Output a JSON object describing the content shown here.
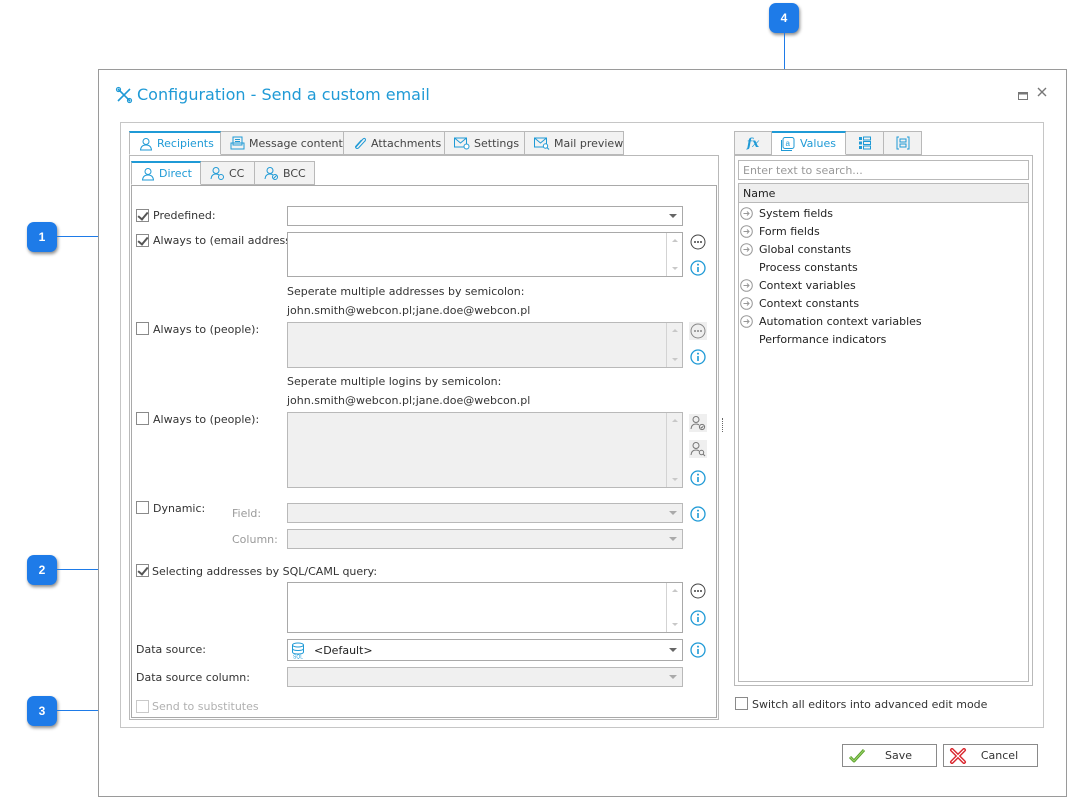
{
  "callouts": [
    "1",
    "2",
    "3",
    "4"
  ],
  "dialog": {
    "title": "Configuration - Send a custom email",
    "maximize_label": "□",
    "close_label": "✕"
  },
  "main_tabs": [
    {
      "label": "Recipients",
      "icon": "user-icon",
      "active": true
    },
    {
      "label": "Message content",
      "icon": "message-icon",
      "active": false
    },
    {
      "label": "Attachments",
      "icon": "paperclip-icon",
      "active": false
    },
    {
      "label": "Settings",
      "icon": "mail-settings-icon",
      "active": false
    },
    {
      "label": "Mail preview",
      "icon": "mail-preview-icon",
      "active": false
    }
  ],
  "sub_tabs": [
    {
      "label": "Direct",
      "icon": "user-icon",
      "active": true
    },
    {
      "label": "CC",
      "icon": "user-cc-icon",
      "active": false
    },
    {
      "label": "BCC",
      "icon": "user-bcc-icon",
      "active": false
    }
  ],
  "form": {
    "predefined": {
      "label": "Predefined:",
      "checked": true,
      "value": ""
    },
    "always_to_email": {
      "label": "Always to (email address):",
      "checked": true,
      "value": "",
      "hint": "Seperate multiple addresses by semicolon:",
      "example": "john.smith@webcon.pl;jane.doe@webcon.pl"
    },
    "always_to_people_1": {
      "label": "Always to (people):",
      "checked": false,
      "value": "",
      "hint": "Seperate multiple logins by semicolon:",
      "example": "john.smith@webcon.pl;jane.doe@webcon.pl"
    },
    "always_to_people_2": {
      "label": "Always to (people):",
      "checked": false,
      "value": ""
    },
    "dynamic": {
      "label": "Dynamic:",
      "checked": false,
      "field_label": "Field:",
      "field_value": "",
      "column_label": "Column:",
      "column_value": ""
    },
    "sql_query": {
      "label": "Selecting addresses by SQL/CAML query:",
      "checked": true,
      "value": ""
    },
    "data_source": {
      "label": "Data source:",
      "value": "<Default>",
      "icon": "sql-database-icon"
    },
    "data_source_column": {
      "label": "Data source column:",
      "value": ""
    },
    "send_to_substitutes": {
      "label": "Send to substitutes",
      "checked": false,
      "disabled": true
    }
  },
  "right_panel": {
    "tabs": [
      {
        "label": "",
        "icon": "function-icon",
        "active": false
      },
      {
        "label": "Values",
        "icon": "values-icon",
        "active": true
      },
      {
        "label": "",
        "icon": "list-icon",
        "active": false
      },
      {
        "label": "",
        "icon": "bracket-list-icon",
        "active": false
      }
    ],
    "search_placeholder": "Enter text to search...",
    "column_header": "Name",
    "items": [
      {
        "label": "System fields",
        "expandable": true
      },
      {
        "label": "Form fields",
        "expandable": true
      },
      {
        "label": "Global constants",
        "expandable": true
      },
      {
        "label": "Process constants",
        "expandable": false
      },
      {
        "label": "Context variables",
        "expandable": true
      },
      {
        "label": "Context constants",
        "expandable": true
      },
      {
        "label": "Automation context variables",
        "expandable": true
      },
      {
        "label": "Performance indicators",
        "expandable": false
      }
    ],
    "advanced_mode": {
      "label": "Switch all editors into advanced edit mode",
      "checked": false
    }
  },
  "footer": {
    "save_label": "Save",
    "cancel_label": "Cancel"
  },
  "colors": {
    "accent": "#1f9ad6",
    "callout": "#1e7be8",
    "save_icon": "#5aa02c",
    "cancel_icon": "#d9262e"
  }
}
